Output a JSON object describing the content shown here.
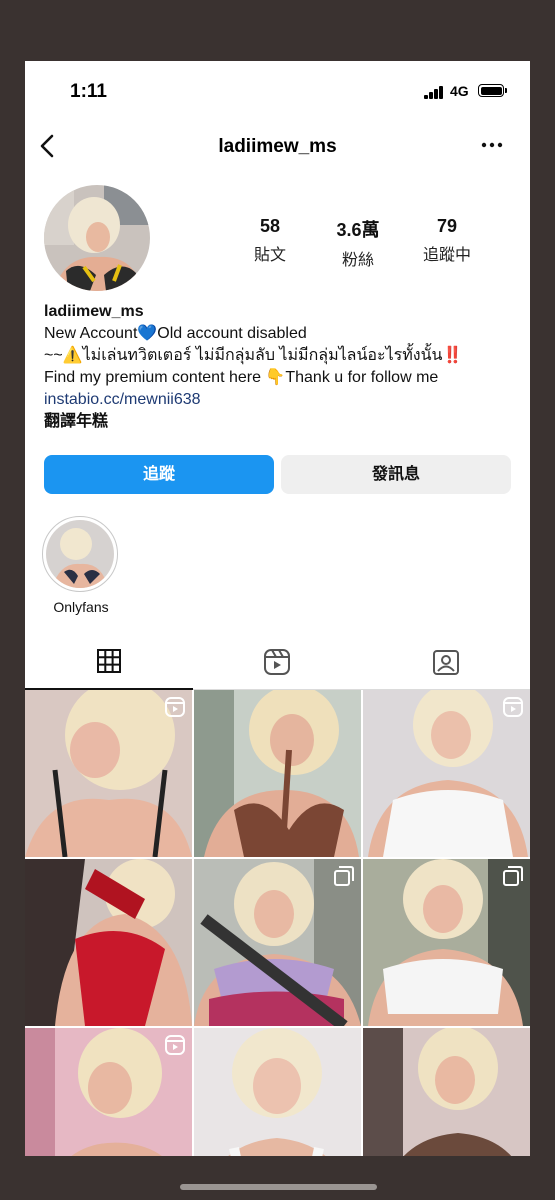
{
  "status_bar": {
    "time": "1:11",
    "network": "4G"
  },
  "nav": {
    "title": "ladiimew_ms"
  },
  "profile": {
    "stats": [
      {
        "value": "58",
        "label": "貼文"
      },
      {
        "value": "3.6萬",
        "label": "粉絲"
      },
      {
        "value": "79",
        "label": "追蹤中"
      }
    ],
    "username": "ladiimew_ms",
    "bio_line1": "New Account💙Old account disabled",
    "bio_line2": "~~⚠️ไม่เล่นทวิตเตอร์ ไม่มีกลุ่มลับ ไม่มีกลุ่มไลน์อะไรทั้งนั้น‼️",
    "bio_line3": "Find my premium content here 👇Thank u for follow me",
    "link": "instabio.cc/mewnii638",
    "translate": "翻譯年糕"
  },
  "buttons": {
    "follow": "追蹤",
    "message": "發訊息"
  },
  "highlights": [
    {
      "label": "Onlyfans"
    }
  ],
  "tabs": [
    {
      "icon": "grid-icon",
      "active": true
    },
    {
      "icon": "reels-icon",
      "active": false
    },
    {
      "icon": "tagged-icon",
      "active": false
    }
  ],
  "grid_badges": [
    "reel",
    "none",
    "reel",
    "none",
    "multi",
    "multi",
    "reel",
    "none",
    "none"
  ],
  "colors": {
    "accent": "#1b95f1",
    "link": "#1e3a73",
    "button_secondary": "#efefef"
  }
}
